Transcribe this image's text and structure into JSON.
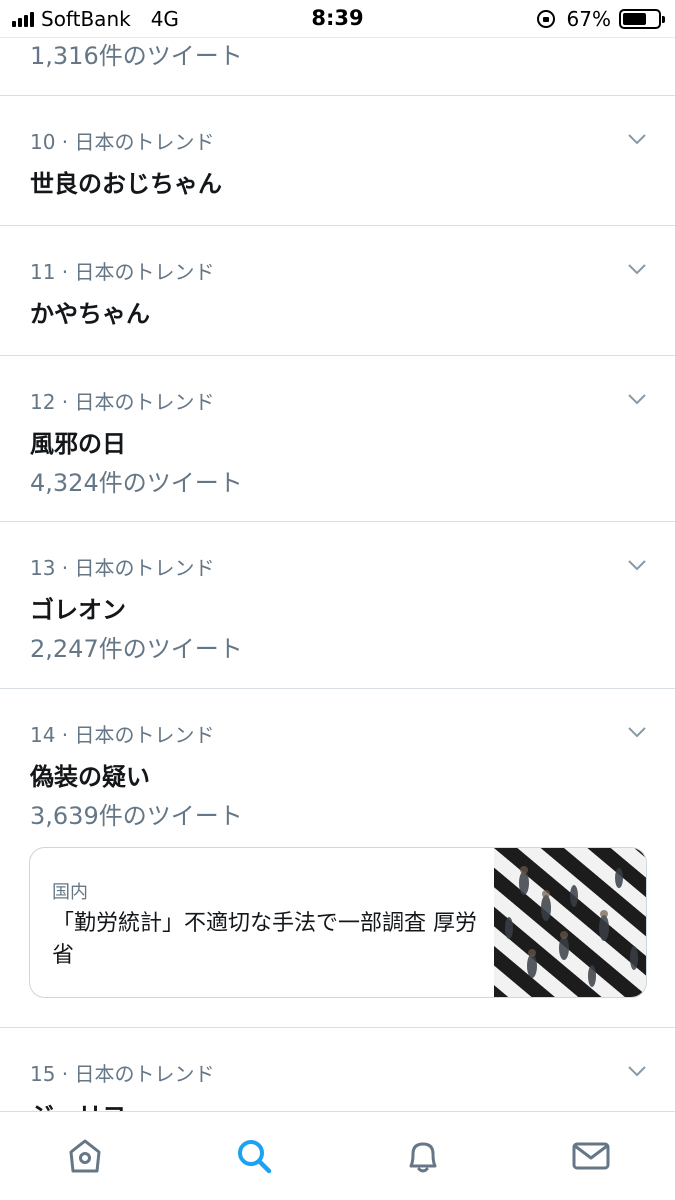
{
  "status_bar": {
    "carrier": "SoftBank",
    "network": "4G",
    "time": "8:39",
    "battery_percent": "67%",
    "battery_level": 0.67,
    "icons": [
      "signal-icon",
      "rotation-lock-icon",
      "battery-icon"
    ]
  },
  "top_partial": {
    "count": "1,316件のツイート"
  },
  "trends": [
    {
      "meta": "10 · 日本のトレンド",
      "name": "世良のおじちゃん",
      "count": ""
    },
    {
      "meta": "11 · 日本のトレンド",
      "name": "かやちゃん",
      "count": ""
    },
    {
      "meta": "12 · 日本のトレンド",
      "name": "風邪の日",
      "count": "4,324件のツイート"
    },
    {
      "meta": "13 · 日本のトレンド",
      "name": "ゴレオン",
      "count": "2,247件のツイート"
    },
    {
      "meta": "14 · 日本のトレンド",
      "name": "偽装の疑い",
      "count": "3,639件のツイート"
    },
    {
      "meta": "15 · 日本のトレンド",
      "name": "ジェリコ",
      "count": ""
    }
  ],
  "news_card": {
    "category": "国内",
    "title": "「勤労統計」不適切な手法で一部調査 厚労省",
    "image": "crosswalk-crowd-photo"
  },
  "tab_bar": {
    "tabs": [
      {
        "name": "home",
        "icon": "home-icon"
      },
      {
        "name": "search",
        "icon": "search-icon",
        "active": true
      },
      {
        "name": "notifications",
        "icon": "bell-icon"
      },
      {
        "name": "messages",
        "icon": "mail-icon"
      }
    ],
    "active_color": "#1da1f2",
    "inactive_color": "#657786"
  },
  "colors": {
    "secondary_text": "#657786",
    "primary_text": "#14171a",
    "divider": "#d8dee3",
    "accent": "#1da1f2"
  }
}
